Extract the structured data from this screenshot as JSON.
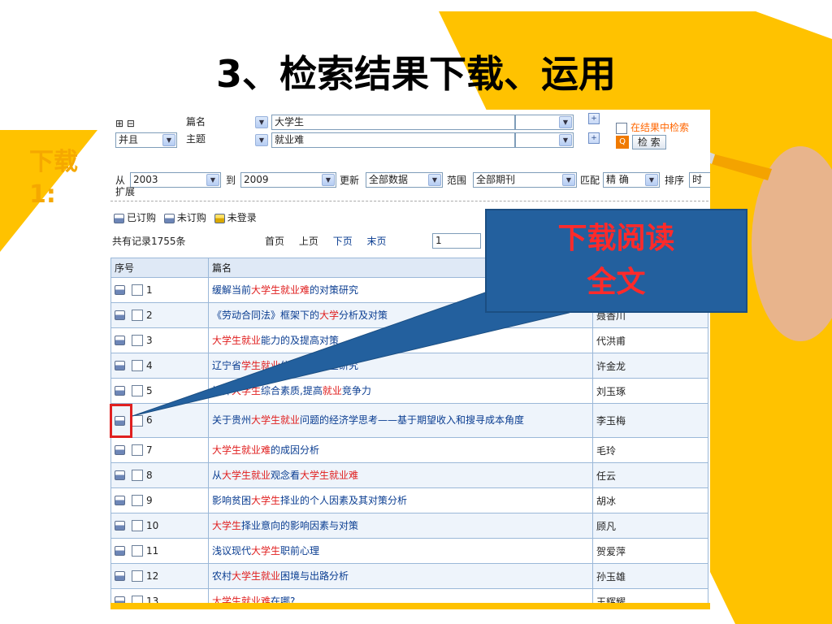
{
  "slide": {
    "title": "3、检索结果下载、运用",
    "side_label_line1": "下载",
    "side_label_line2": "1:",
    "callout_line1": "下载阅读",
    "callout_line2": "全文"
  },
  "search": {
    "expand_icons": "⊞ ⊟",
    "field1": "篇名",
    "keyword1": "大学生",
    "logic": "并且",
    "field2": "主题",
    "keyword2": "就业难",
    "search_in_results": "在结果中检索",
    "search_button": "检 索",
    "from_label": "从",
    "from_year": "2003",
    "to_label": "到",
    "to_year": "2009",
    "update_label": "更新",
    "update_value": "全部数据",
    "range_label": "范围",
    "range_value": "全部期刊",
    "match_label": "匹配",
    "match_value": "精 确",
    "sort_label": "排序",
    "sort_value": "时",
    "expand_label": "扩展"
  },
  "legend": {
    "subscribed": "已订购",
    "unsubscribed": "未订购",
    "not_logged_in": "未登录"
  },
  "pager": {
    "total_records": "共有记录1755条",
    "first": "首页",
    "prev": "上页",
    "next": "下页",
    "last": "末页",
    "page_value": "1"
  },
  "table": {
    "headers": [
      "序号",
      "篇名",
      ""
    ],
    "rows": [
      {
        "num": "1",
        "title_parts": [
          [
            "缓解当前",
            0
          ],
          [
            "大学生就业难",
            1
          ],
          [
            "的对策研究",
            0
          ]
        ],
        "author": ""
      },
      {
        "num": "2",
        "title_parts": [
          [
            "《劳动合同法》框架下的",
            0
          ],
          [
            "大学",
            1
          ],
          [
            "分析及对策",
            0
          ]
        ],
        "author": "聂香川"
      },
      {
        "num": "3",
        "title_parts": [
          [
            "大学生就业",
            1
          ],
          [
            "能力的",
            0
          ],
          [
            "及提高对策",
            0
          ]
        ],
        "author": "代洪甫"
      },
      {
        "num": "4",
        "title_parts": [
          [
            "辽宁省",
            0
          ],
          [
            "学生就业",
            1
          ],
          [
            "信息供求调查研究",
            0
          ]
        ],
        "author": "许金龙"
      },
      {
        "num": "5",
        "title_parts": [
          [
            "培养",
            0
          ],
          [
            "大学生",
            1
          ],
          [
            "综合素质,提高",
            0
          ],
          [
            "就业",
            1
          ],
          [
            "竞争力",
            0
          ]
        ],
        "author": "刘玉琢"
      },
      {
        "num": "6",
        "title_parts": [
          [
            "关于贵州",
            0
          ],
          [
            "大学生就业",
            1
          ],
          [
            "问题的经济学思考——基于期望收入和搜寻成本角度",
            0
          ]
        ],
        "author": "李玉梅"
      },
      {
        "num": "7",
        "title_parts": [
          [
            "大学生就业难",
            1
          ],
          [
            "的成因分析",
            0
          ]
        ],
        "author": "毛玲"
      },
      {
        "num": "8",
        "title_parts": [
          [
            "从",
            0
          ],
          [
            "大学生就业",
            1
          ],
          [
            "观念看",
            0
          ],
          [
            "大学生就业难",
            1
          ]
        ],
        "author": "任云"
      },
      {
        "num": "9",
        "title_parts": [
          [
            "影响贫困",
            0
          ],
          [
            "大学生",
            1
          ],
          [
            "择业的个人因素及其对策分析",
            0
          ]
        ],
        "author": "胡冰"
      },
      {
        "num": "10",
        "title_parts": [
          [
            "大学生",
            1
          ],
          [
            "择业意向的影响因素与对策",
            0
          ]
        ],
        "author": "顾凡"
      },
      {
        "num": "11",
        "title_parts": [
          [
            "浅议现代",
            0
          ],
          [
            "大学生",
            1
          ],
          [
            "职前心理",
            0
          ]
        ],
        "author": "贺爱萍"
      },
      {
        "num": "12",
        "title_parts": [
          [
            "农村",
            0
          ],
          [
            "大学生就业",
            1
          ],
          [
            "困境与出路分析",
            0
          ]
        ],
        "author": "孙玉雄"
      },
      {
        "num": "13",
        "title_parts": [
          [
            "大学生就业难",
            1
          ],
          [
            "在哪?",
            0
          ]
        ],
        "author": "王辉耀"
      }
    ]
  },
  "colors": {
    "accent_yellow": "#ffc200",
    "callout_blue": "#23609e",
    "callout_text": "#ff2a2a",
    "keyword_red": "#e02020",
    "title_blue": "#0a3d91"
  }
}
